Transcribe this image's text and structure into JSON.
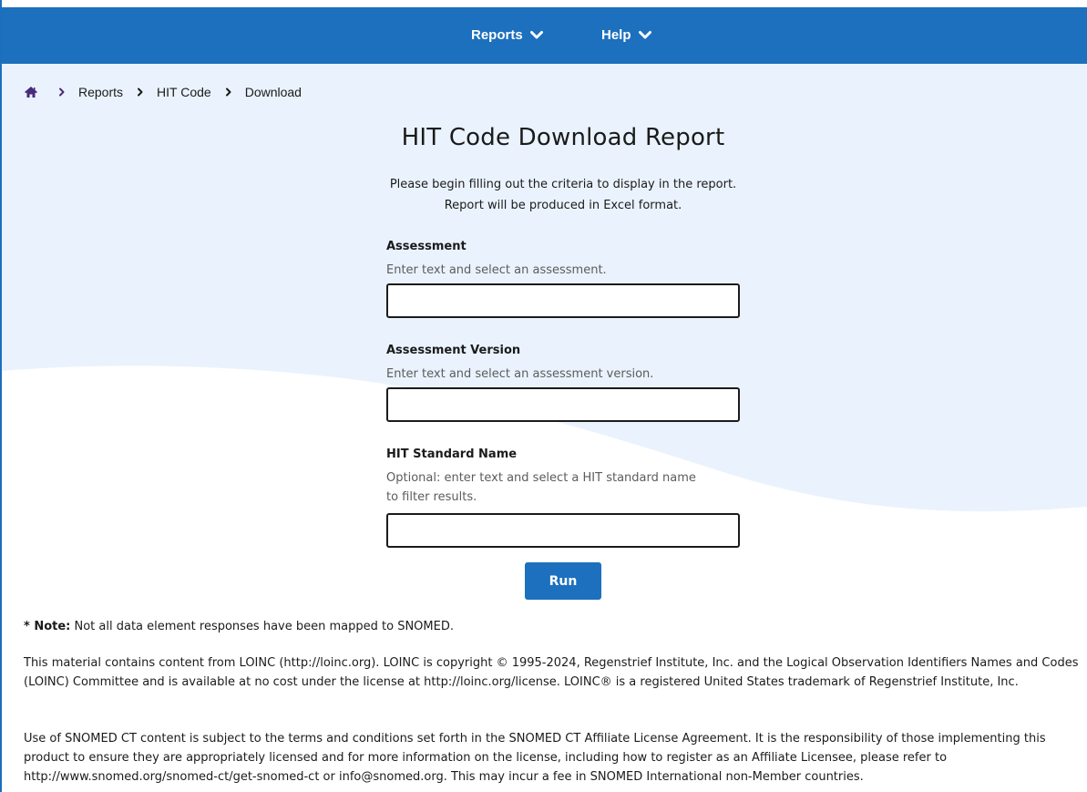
{
  "nav": {
    "items": [
      {
        "label": "Reports",
        "icon": "chevron-down-icon"
      },
      {
        "label": "Help",
        "icon": "chevron-down-icon"
      }
    ]
  },
  "breadcrumb": {
    "home_icon": "home-icon",
    "items": [
      "Reports",
      "HIT Code",
      "Download"
    ]
  },
  "page": {
    "title": "HIT Code Download Report",
    "intro_line1": "Please begin filling out the criteria to display in the report.",
    "intro_line2": "Report will be produced in Excel format."
  },
  "form": {
    "assessment": {
      "label": "Assessment",
      "hint": "Enter text and select an assessment.",
      "value": ""
    },
    "assessment_version": {
      "label": "Assessment Version",
      "hint": "Enter text and select an assessment version.",
      "value": ""
    },
    "hit_standard_name": {
      "label": "HIT Standard Name",
      "hint_line1": "Optional: enter text and select a HIT standard name",
      "hint_line2": "to filter results.",
      "value": ""
    },
    "run_label": "Run"
  },
  "footer": {
    "note_prefix": "* Note:",
    "note_text": " Not all data element responses have been mapped to SNOMED.",
    "loinc_text": "This material contains content from LOINC (http://loinc.org). LOINC is copyright © 1995-2024, Regenstrief Institute, Inc. and the Logical Observation Identifiers Names and Codes (LOINC) Committee and is available at no cost under the license at http://loinc.org/license. LOINC® is a registered United States trademark of Regenstrief Institute, Inc.",
    "snomed_text": "Use of SNOMED CT content is subject to the terms and conditions set forth in the SNOMED CT Affiliate License Agreement. It is the responsibility of those implementing this product to ensure they are appropriately licensed and for more information on the license, including how to register as an Affiliate Licensee, please refer to http://www.snomed.org/snomed-ct/get-snomed-ct or info@snomed.org. This may incur a fee in SNOMED International non-Member countries."
  },
  "colors": {
    "nav_blue": "#1c70bd",
    "wave_light_blue": "#eaf3fd",
    "breadcrumb_home": "#4a2a7a"
  }
}
